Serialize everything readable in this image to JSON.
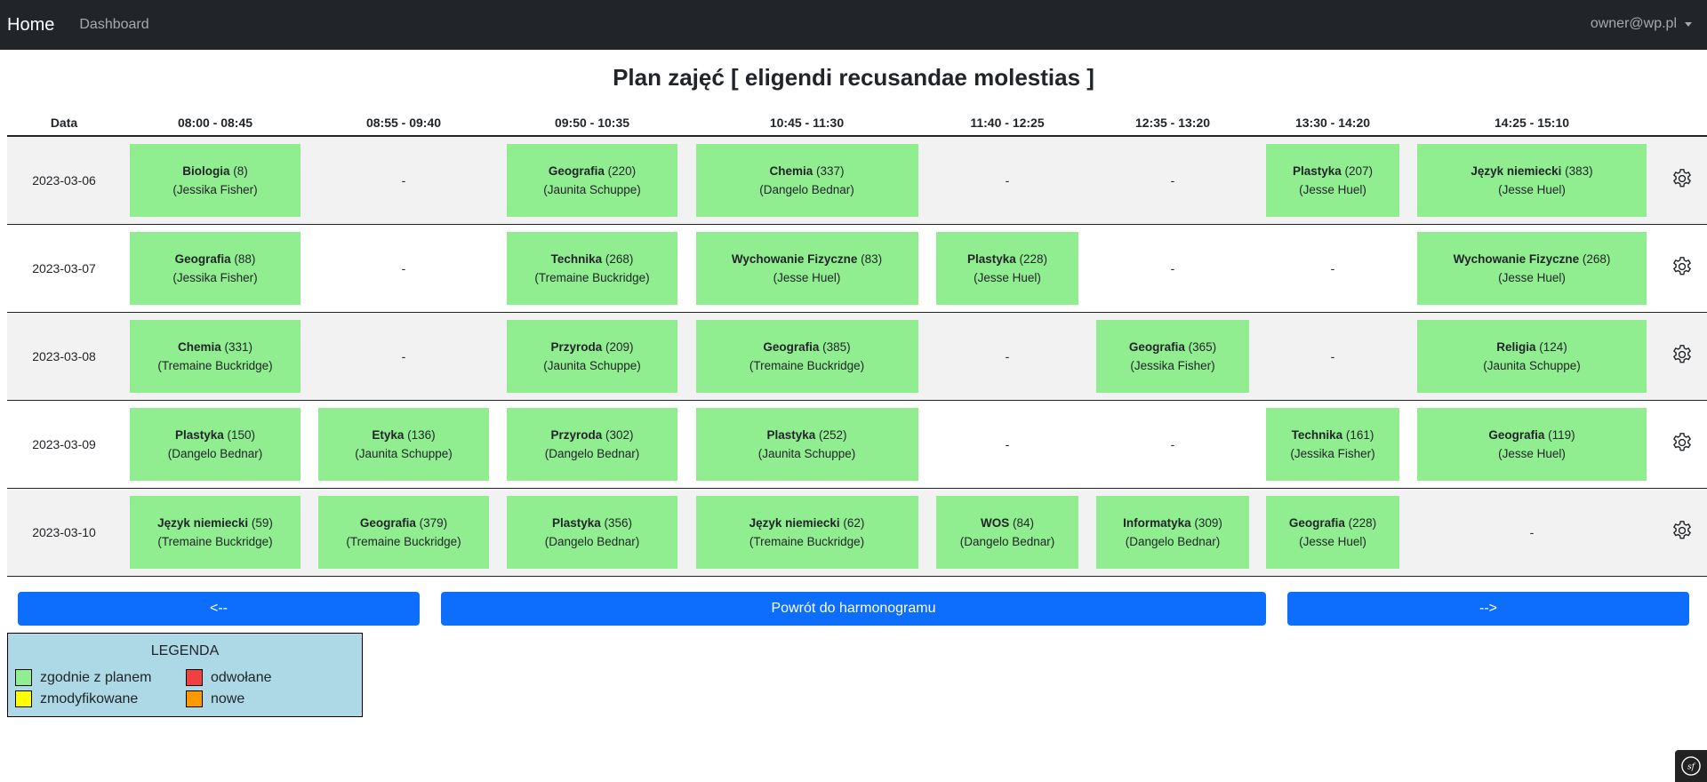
{
  "navbar": {
    "brand": "Home",
    "links": [
      "Dashboard"
    ],
    "user": "owner@wp.pl"
  },
  "page": {
    "title": "Plan zajęć [ eligendi recusandae molestias ]"
  },
  "table": {
    "headers": [
      "Data",
      "08:00 - 08:45",
      "08:55 - 09:40",
      "09:50 - 10:35",
      "10:45 - 11:30",
      "11:40 - 12:25",
      "12:35 - 13:20",
      "13:30 - 14:20",
      "14:25 - 15:10"
    ],
    "rows": [
      {
        "date": "2023-03-06",
        "cells": [
          {
            "subject": "Biologia",
            "room": "(8)",
            "teacher": "(Jessika Fisher)"
          },
          null,
          {
            "subject": "Geografia",
            "room": "(220)",
            "teacher": "(Jaunita Schuppe)"
          },
          {
            "subject": "Chemia",
            "room": "(337)",
            "teacher": "(Dangelo Bednar)"
          },
          null,
          null,
          {
            "subject": "Plastyka",
            "room": "(207)",
            "teacher": "(Jesse Huel)"
          },
          {
            "subject": "Język niemiecki",
            "room": "(383)",
            "teacher": "(Jesse Huel)"
          }
        ]
      },
      {
        "date": "2023-03-07",
        "cells": [
          {
            "subject": "Geografia",
            "room": "(88)",
            "teacher": "(Jessika Fisher)"
          },
          null,
          {
            "subject": "Technika",
            "room": "(268)",
            "teacher": "(Tremaine Buckridge)"
          },
          {
            "subject": "Wychowanie Fizyczne",
            "room": "(83)",
            "teacher": "(Jesse Huel)"
          },
          {
            "subject": "Plastyka",
            "room": "(228)",
            "teacher": "(Jesse Huel)"
          },
          null,
          null,
          {
            "subject": "Wychowanie Fizyczne",
            "room": "(268)",
            "teacher": "(Jesse Huel)"
          }
        ]
      },
      {
        "date": "2023-03-08",
        "cells": [
          {
            "subject": "Chemia",
            "room": "(331)",
            "teacher": "(Tremaine Buckridge)"
          },
          null,
          {
            "subject": "Przyroda",
            "room": "(209)",
            "teacher": "(Jaunita Schuppe)"
          },
          {
            "subject": "Geografia",
            "room": "(385)",
            "teacher": "(Tremaine Buckridge)"
          },
          null,
          {
            "subject": "Geografia",
            "room": "(365)",
            "teacher": "(Jessika Fisher)"
          },
          null,
          {
            "subject": "Religia",
            "room": "(124)",
            "teacher": "(Jaunita Schuppe)"
          }
        ]
      },
      {
        "date": "2023-03-09",
        "cells": [
          {
            "subject": "Plastyka",
            "room": "(150)",
            "teacher": "(Dangelo Bednar)"
          },
          {
            "subject": "Etyka",
            "room": "(136)",
            "teacher": "(Jaunita Schuppe)"
          },
          {
            "subject": "Przyroda",
            "room": "(302)",
            "teacher": "(Dangelo Bednar)"
          },
          {
            "subject": "Plastyka",
            "room": "(252)",
            "teacher": "(Jaunita Schuppe)"
          },
          null,
          null,
          {
            "subject": "Technika",
            "room": "(161)",
            "teacher": "(Jessika Fisher)"
          },
          {
            "subject": "Geografia",
            "room": "(119)",
            "teacher": "(Jesse Huel)"
          }
        ]
      },
      {
        "date": "2023-03-10",
        "cells": [
          {
            "subject": "Język niemiecki",
            "room": "(59)",
            "teacher": "(Tremaine Buckridge)"
          },
          {
            "subject": "Geografia",
            "room": "(379)",
            "teacher": "(Tremaine Buckridge)"
          },
          {
            "subject": "Plastyka",
            "room": "(356)",
            "teacher": "(Dangelo Bednar)"
          },
          {
            "subject": "Język niemiecki",
            "room": "(62)",
            "teacher": "(Tremaine Buckridge)"
          },
          {
            "subject": "WOS",
            "room": "(84)",
            "teacher": "(Dangelo Bednar)"
          },
          {
            "subject": "Informatyka",
            "room": "(309)",
            "teacher": "(Dangelo Bednar)"
          },
          {
            "subject": "Geografia",
            "room": "(228)",
            "teacher": "(Jesse Huel)"
          },
          null
        ]
      }
    ],
    "empty_marker": "-",
    "row_action_icon": "gear-icon"
  },
  "buttons": {
    "prev": "<--",
    "back": "Powrót do harmonogramu",
    "next": "-->"
  },
  "legend": {
    "title": "LEGENDA",
    "items": [
      {
        "label": "zgodnie z planem",
        "color": "#90ee90"
      },
      {
        "label": "odwołane",
        "color": "#f04040"
      },
      {
        "label": "zmodyfikowane",
        "color": "#ffff00"
      },
      {
        "label": "nowe",
        "color": "#ff9900"
      }
    ]
  },
  "colors": {
    "navbar": "#212529",
    "primary": "#0d6efd",
    "planned": "#90ee90",
    "legend_bg": "#add8e6"
  }
}
